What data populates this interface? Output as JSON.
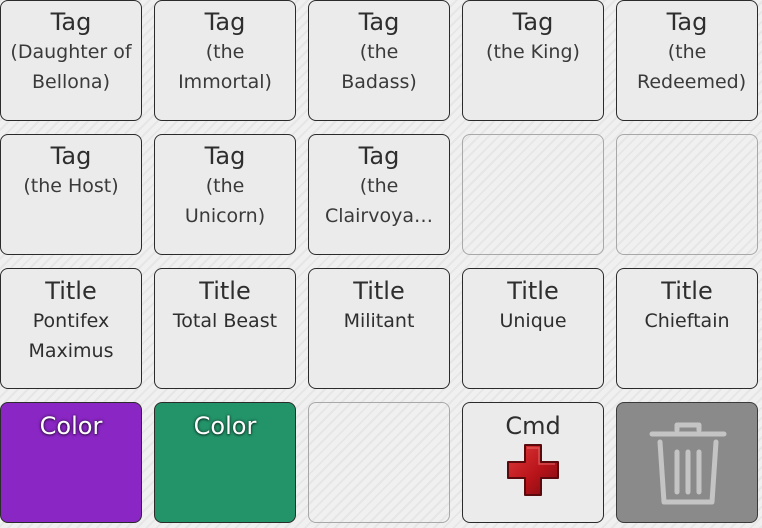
{
  "rows": [
    [
      {
        "head": "Tag",
        "sub": "(Daughter of Bellona)"
      },
      {
        "head": "Tag",
        "sub": "(the Immortal)"
      },
      {
        "head": "Tag",
        "sub": "(the Badass)"
      },
      {
        "head": "Tag",
        "sub": "(the King)"
      },
      {
        "head": "Tag",
        "sub": "(the Redeemed)"
      }
    ],
    [
      {
        "head": "Tag",
        "sub": "(the Host)"
      },
      {
        "head": "Tag",
        "sub": "(the Unicorn)"
      },
      {
        "head": "Tag",
        "sub": "(the Clairvoya…"
      }
    ],
    [
      {
        "head": "Title",
        "sub": "Pontifex Maximus"
      },
      {
        "head": "Title",
        "sub": "Total Beast"
      },
      {
        "head": "Title",
        "sub": "Militant"
      },
      {
        "head": "Title",
        "sub": "Unique"
      },
      {
        "head": "Title",
        "sub": "Chieftain"
      }
    ]
  ],
  "bottom_row": {
    "color1": {
      "label": "Color",
      "color": "#8a26c4"
    },
    "color2": {
      "label": "Color",
      "color": "#23946a"
    },
    "cmd": {
      "label": "Cmd",
      "icon": "red-cross-icon"
    },
    "trash": {
      "icon": "trash-icon"
    }
  }
}
